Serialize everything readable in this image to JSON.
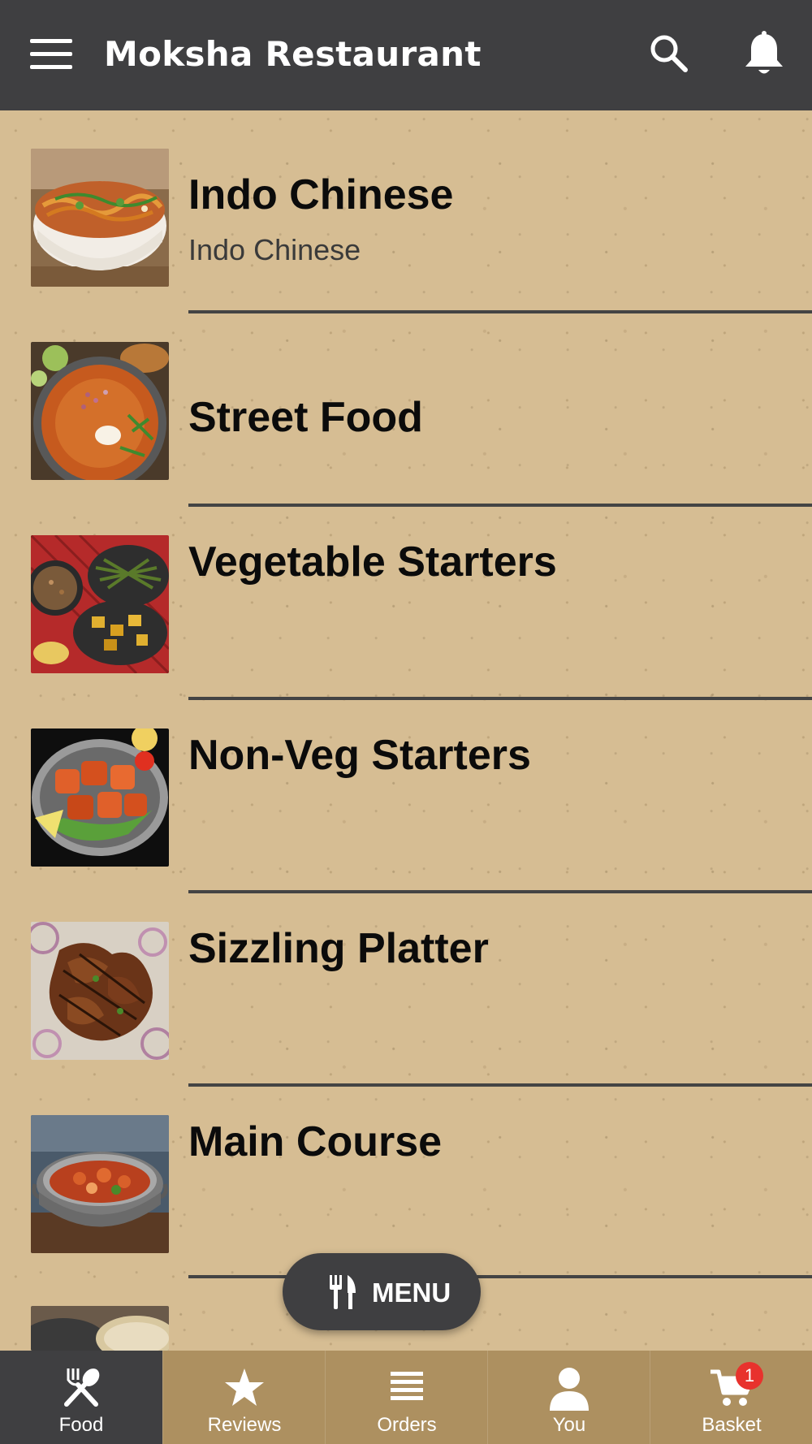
{
  "app_bar": {
    "title": "Moksha Restaurant",
    "menu_icon": "hamburger-icon",
    "search_icon": "search-icon",
    "notification_icon": "bell-icon",
    "background": "#3f3f41"
  },
  "categories": [
    {
      "title": "Indo Chinese",
      "subtitle": "Indo Chinese",
      "image": "noodles-bowl"
    },
    {
      "title": "Street Food",
      "subtitle": "",
      "image": "pav-bhaji"
    },
    {
      "title": "Vegetable Starters",
      "subtitle": "",
      "image": "veg-platter"
    },
    {
      "title": "Non-Veg Starters",
      "subtitle": "",
      "image": "tandoori-platter"
    },
    {
      "title": "Sizzling Platter",
      "subtitle": "",
      "image": "grilled-chicken"
    },
    {
      "title": "Main Course",
      "subtitle": "",
      "image": "kadai-curry"
    },
    {
      "title": "",
      "subtitle": "",
      "image": "partial-dish"
    }
  ],
  "menu_fab": {
    "label": "MENU",
    "icon": "fork-knife-icon"
  },
  "bottom_nav": {
    "items": [
      {
        "label": "Food",
        "icon": "spoon-fork-icon",
        "active": true
      },
      {
        "label": "Reviews",
        "icon": "star-icon",
        "active": false
      },
      {
        "label": "Orders",
        "icon": "list-icon",
        "active": false
      },
      {
        "label": "You",
        "icon": "user-icon",
        "active": false
      },
      {
        "label": "Basket",
        "icon": "cart-icon",
        "active": false,
        "badge": "1"
      }
    ],
    "background": "#ad9060",
    "active_background": "#3f3f41",
    "badge_color": "#e8322d"
  }
}
